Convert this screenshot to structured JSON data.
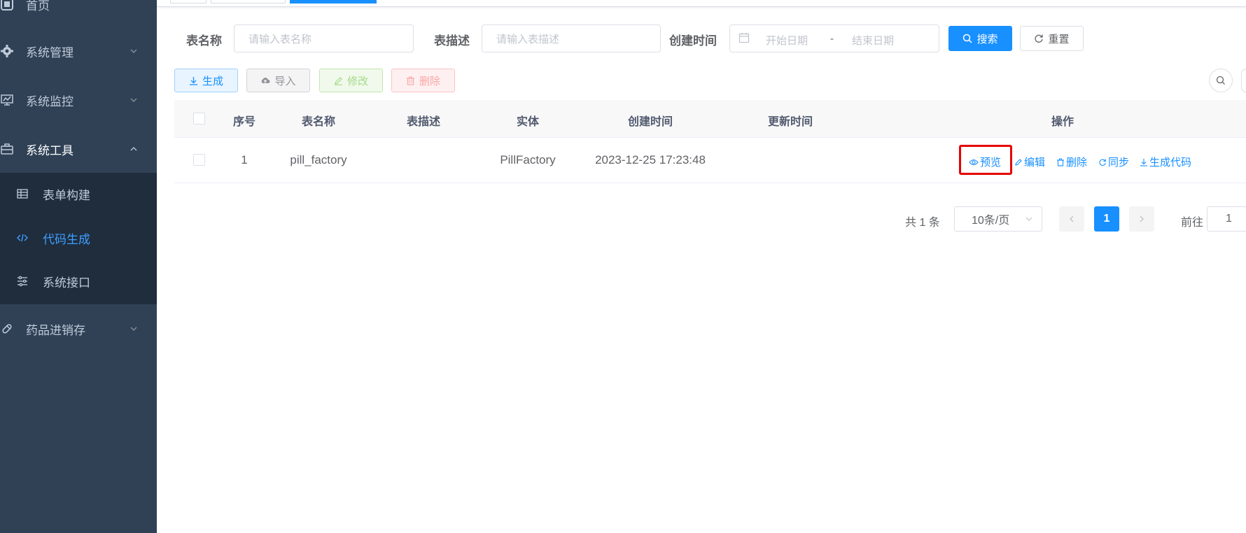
{
  "sidebar": {
    "items": [
      {
        "label": "首页",
        "icon": "dashboard-icon"
      },
      {
        "label": "系统管理",
        "icon": "gear-icon"
      },
      {
        "label": "系统监控",
        "icon": "monitor-icon"
      },
      {
        "label": "系统工具",
        "icon": "toolbox-icon",
        "expanded": true
      },
      {
        "label": "药品进销存",
        "icon": "pill-icon"
      }
    ],
    "submenu": [
      {
        "label": "表单构建",
        "icon": "table-icon"
      },
      {
        "label": "代码生成",
        "icon": "code-icon",
        "active": true
      },
      {
        "label": "系统接口",
        "icon": "sliders-icon"
      }
    ]
  },
  "search": {
    "table_name_label": "表名称",
    "table_name_placeholder": "请输入表名称",
    "table_desc_label": "表描述",
    "table_desc_placeholder": "请输入表描述",
    "create_time_label": "创建时间",
    "start_placeholder": "开始日期",
    "range_separator": "-",
    "end_placeholder": "结束日期",
    "search_button": "搜索",
    "reset_button": "重置"
  },
  "toolbar": {
    "generate": "生成",
    "import": "导入",
    "edit": "修改",
    "delete": "删除"
  },
  "table": {
    "columns": [
      "序号",
      "表名称",
      "表描述",
      "实体",
      "创建时间",
      "更新时间",
      "操作"
    ],
    "rows": [
      {
        "index": "1",
        "table_name": "pill_factory",
        "table_desc": "",
        "entity": "PillFactory",
        "create_time": "2023-12-25 17:23:48",
        "update_time": ""
      }
    ],
    "actions": {
      "preview": "预览",
      "edit": "编辑",
      "delete": "删除",
      "sync": "同步",
      "gen_code": "生成代码"
    }
  },
  "pagination": {
    "total": "共 1 条",
    "page_size": "10条/页",
    "current_page": "1",
    "goto_label": "前往",
    "goto_value": "1"
  },
  "colors": {
    "sidebar_bg": "#304156",
    "submenu_bg": "#1f2d3d",
    "primary": "#1890ff",
    "highlight": "#e60000"
  }
}
